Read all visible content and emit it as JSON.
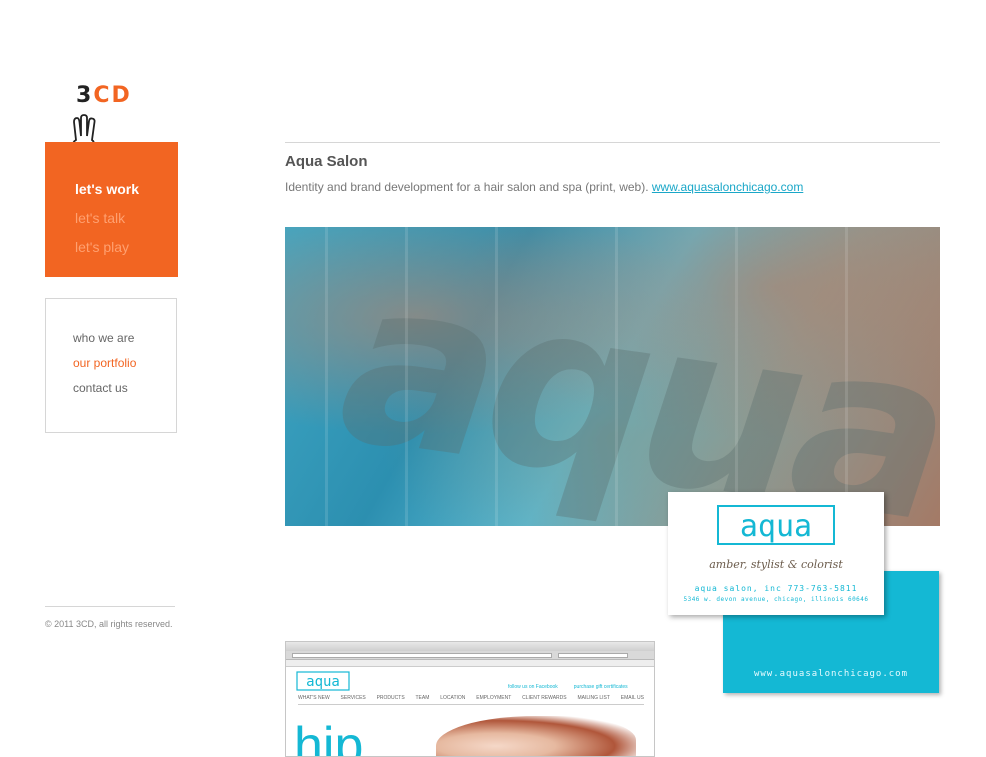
{
  "brand": {
    "three": "3",
    "cd": "CD",
    "accent": "#f26522"
  },
  "primary_nav": [
    {
      "label": "let's work",
      "active": true
    },
    {
      "label": "let's talk",
      "active": false
    },
    {
      "label": "let's play",
      "active": false
    }
  ],
  "secondary_nav": [
    {
      "label": "who we are",
      "active": false
    },
    {
      "label": "our portfolio",
      "active": true
    },
    {
      "label": "contact us",
      "active": false
    }
  ],
  "footer": {
    "copyright": "© 2011 3CD, all rights reserved."
  },
  "project": {
    "title": "Aqua Salon",
    "description": "Identity and brand development for a hair salon and spa (print, web). ",
    "link": "www.aquasalonchicago.com"
  },
  "card": {
    "logo": "aqua",
    "tagline": "amber, stylist & colorist",
    "line1": "aqua salon, inc  773-763-5811",
    "line2": "5346 w. devon avenue, chicago, illinois 60646",
    "back_url": "www.aquasalonchicago.com",
    "accent": "#14b8d4"
  },
  "site_shot": {
    "logo": "aqua",
    "links": [
      "follow us on Facebook",
      "purchase gift certificates"
    ],
    "nav": [
      "WHAT'S NEW",
      "SERVICES",
      "PRODUCTS",
      "TEAM",
      "LOCATION",
      "EMPLOYMENT",
      "CLIENT REWARDS",
      "MAILING LIST",
      "EMAIL US"
    ],
    "hero_text": "hip"
  }
}
